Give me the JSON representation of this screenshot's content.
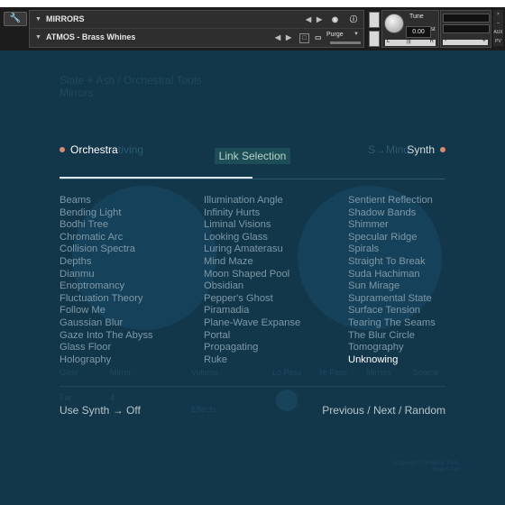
{
  "header": {
    "instrument_name": "MIRRORS",
    "preset_name": "ATMOS - Brass Whines",
    "purge_label": "Purge",
    "tune_label": "Tune",
    "tune_value": "0.00",
    "tune_unit": "st",
    "pan_left": "L",
    "pan_center": "|||",
    "pan_right": "R",
    "volume_minus": "-",
    "volume_plus": "+",
    "side_labels": [
      "S",
      "M",
      "AUX",
      "PV"
    ]
  },
  "background_text": {
    "brand_line": "Slate + Ash / Orchestral Tools",
    "product": "Mirrors",
    "tab_left_ghost": "tiving",
    "tab_right_ghost": "S→Mind",
    "row1": [
      "Glide",
      "Mirror",
      "Volume",
      "Lo Pass",
      "Hi Pass",
      "Mirrors",
      "Source"
    ],
    "row2": [
      "Far",
      "4",
      "Effects"
    ],
    "copyright": "Copyright Orchestral Tools, Slate & Ash"
  },
  "tabs": {
    "left": "Orchestra",
    "right": "Synth",
    "link_selection": "Link Selection"
  },
  "presets": {
    "col1": [
      "Beams",
      "Bending Light",
      "Bodhi Tree",
      "Chromatic Arc",
      "Collision Spectra",
      "Depths",
      "Dianmu",
      "Enoptromancy",
      "Fluctuation Theory",
      "Follow Me",
      "Gaussian Blur",
      "Gaze Into The Abyss",
      "Glass Floor",
      "Holography"
    ],
    "col2": [
      "Illumination Angle",
      "Infinity Hurts",
      "Liminal Visions",
      "Looking Glass",
      "Luring Amaterasu",
      "Mind Maze",
      "Moon Shaped Pool",
      "Obsidian",
      "Pepper's Ghost",
      "Piramadia",
      "Plane-Wave Expanse",
      "Portal",
      "Propagating",
      "Ruke"
    ],
    "col3": [
      "Sentient Reflection",
      "Shadow Bands",
      "Shimmer",
      "Specular Ridge",
      "Spirals",
      "Straight To Break",
      "Suda Hachiman",
      "Sun Mirage",
      "Supramental State",
      "Surface Tension",
      "Tearing The Seams",
      "The Blur Circle",
      "Tomography",
      "Unknowing"
    ],
    "selected": "Unknowing"
  },
  "footer": {
    "use_synth": "Use Synth → Off",
    "prev_next_random": "Previous / Next / Random"
  },
  "colors": {
    "background": "#12364a",
    "accent_dot": "#d9896e",
    "text_dim": "#7e99a6",
    "text_selected": "#ffffff"
  }
}
